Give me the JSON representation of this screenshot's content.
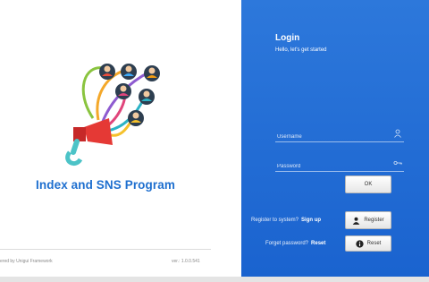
{
  "app": {
    "title": "Index and SNS Program"
  },
  "footer": {
    "powered": "ered by Unigui Framework",
    "version": "ver.: 1.0.0.541"
  },
  "login": {
    "title": "Login",
    "subtitle": "Hello, let's get started",
    "username_placeholder": "Username",
    "password_placeholder": "Password",
    "ok_label": "OK",
    "register_question": "Register to system?",
    "signup_link": "Sign up",
    "register_label": "Register",
    "forget_question": "Forget password?",
    "reset_link": "Reset",
    "reset_label": "Reset"
  },
  "icons": {
    "logo": "social-network-megaphone-logo",
    "username": "user-icon",
    "password": "key-icon",
    "register": "user-add-icon",
    "reset": "info-icon"
  },
  "colors": {
    "accent": "#1e6fcf",
    "panel": "#2d78db"
  }
}
